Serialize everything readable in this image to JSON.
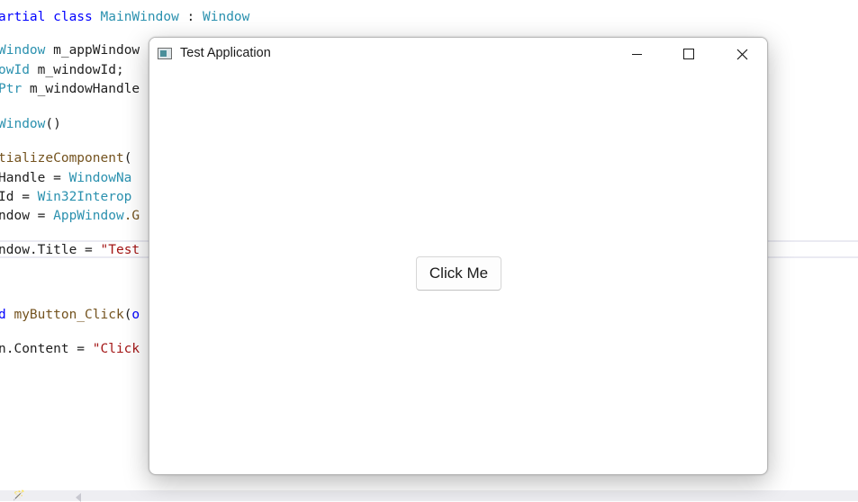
{
  "editor": {
    "lines": [
      [
        {
          "t": "artial ",
          "c": "kw"
        },
        {
          "t": "class ",
          "c": "kw"
        },
        {
          "t": "MainWindow",
          "c": "type"
        },
        {
          "t": " : ",
          "c": "plain"
        },
        {
          "t": "Window",
          "c": "type"
        }
      ],
      [
        {
          "t": "Window",
          "c": "type"
        },
        {
          "t": " m_appWindow",
          "c": "plain"
        }
      ],
      [
        {
          "t": "owId",
          "c": "type"
        },
        {
          "t": " m_windowId;",
          "c": "plain"
        }
      ],
      [
        {
          "t": "Ptr",
          "c": "type"
        },
        {
          "t": " m_windowHandle",
          "c": "plain"
        }
      ],
      [
        {
          "t": "Window",
          "c": "type"
        },
        {
          "t": "()",
          "c": "plain"
        }
      ],
      [
        {
          "t": "tializeComponent",
          "c": "method"
        },
        {
          "t": "(",
          "c": "plain"
        }
      ],
      [
        {
          "t": "Handle = ",
          "c": "plain"
        },
        {
          "t": "WindowNa",
          "c": "type"
        }
      ],
      [
        {
          "t": "Id = ",
          "c": "plain"
        },
        {
          "t": "Win32Interop",
          "c": "type"
        }
      ],
      [
        {
          "t": "ndow = ",
          "c": "plain"
        },
        {
          "t": "AppWindow",
          "c": "type"
        },
        {
          "t": ".G",
          "c": "method"
        }
      ],
      [
        {
          "t": "ndow.Title = ",
          "c": "plain"
        },
        {
          "t": "\"Test",
          "c": "str"
        }
      ],
      [
        {
          "t": "d ",
          "c": "kw"
        },
        {
          "t": "myButton_Click",
          "c": "method"
        },
        {
          "t": "(",
          "c": "plain"
        },
        {
          "t": "o",
          "c": "kw"
        }
      ],
      [
        {
          "t": "n.Content = ",
          "c": "plain"
        },
        {
          "t": "\"Click",
          "c": "str"
        }
      ]
    ]
  },
  "status": {
    "tool_icon": "🪄"
  },
  "window": {
    "title": "Test Application",
    "app_icon": "app-window-icon",
    "minimize_icon": "minimize-icon",
    "maximize_icon": "maximize-icon",
    "close_icon": "close-icon",
    "close_glyph": "✕"
  },
  "content": {
    "button_label": "Click Me"
  }
}
